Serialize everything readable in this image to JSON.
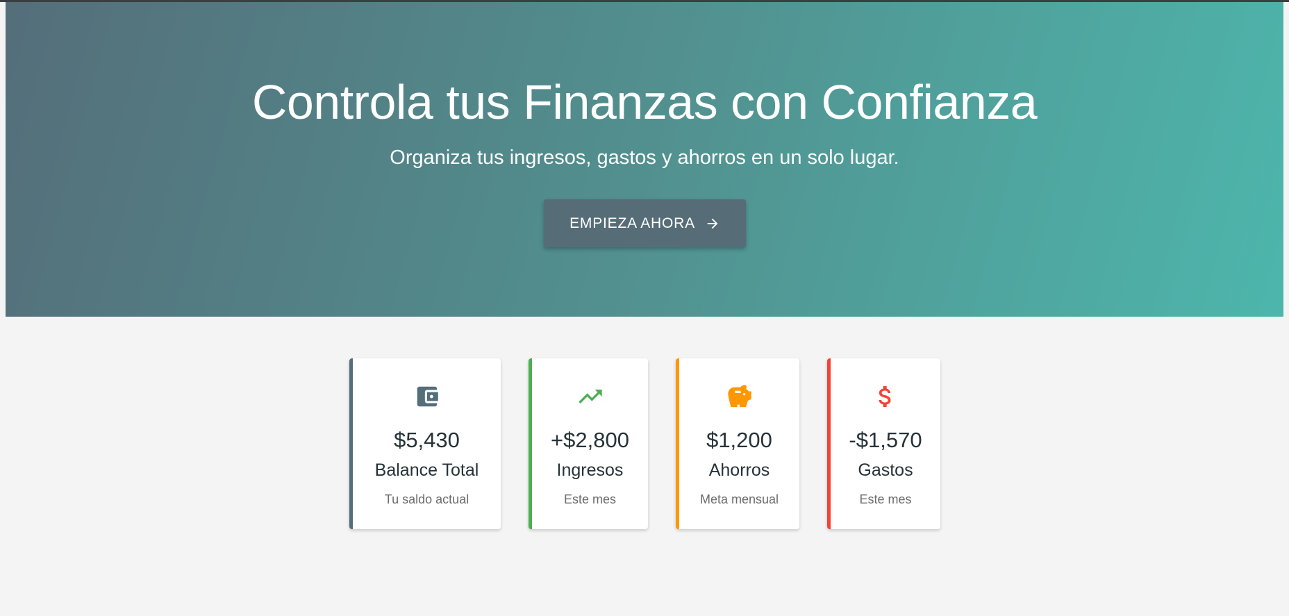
{
  "hero": {
    "title": "Controla tus Finanzas con Confianza",
    "subtitle": "Organiza tus ingresos, gastos y ahorros en un solo lugar.",
    "cta_label": "EMPIEZA AHORA",
    "cta_icon": "arrow-right-icon"
  },
  "colors": {
    "hero_gradient_start": "#546e7a",
    "hero_gradient_end": "#4db6ac",
    "button": "#566d77",
    "balance": "#546e7a",
    "ingresos": "#4caf50",
    "ahorros": "#ff9800",
    "gastos": "#f44336"
  },
  "cards": [
    {
      "icon": "wallet-icon",
      "value": "$5,430",
      "label": "Balance Total",
      "caption": "Tu saldo actual"
    },
    {
      "icon": "trending-up-icon",
      "value": "+$2,800",
      "label": "Ingresos",
      "caption": "Este mes"
    },
    {
      "icon": "piggy-bank-icon",
      "value": "$1,200",
      "label": "Ahorros",
      "caption": "Meta mensual"
    },
    {
      "icon": "dollar-icon",
      "value": "-$1,570",
      "label": "Gastos",
      "caption": "Este mes"
    }
  ]
}
